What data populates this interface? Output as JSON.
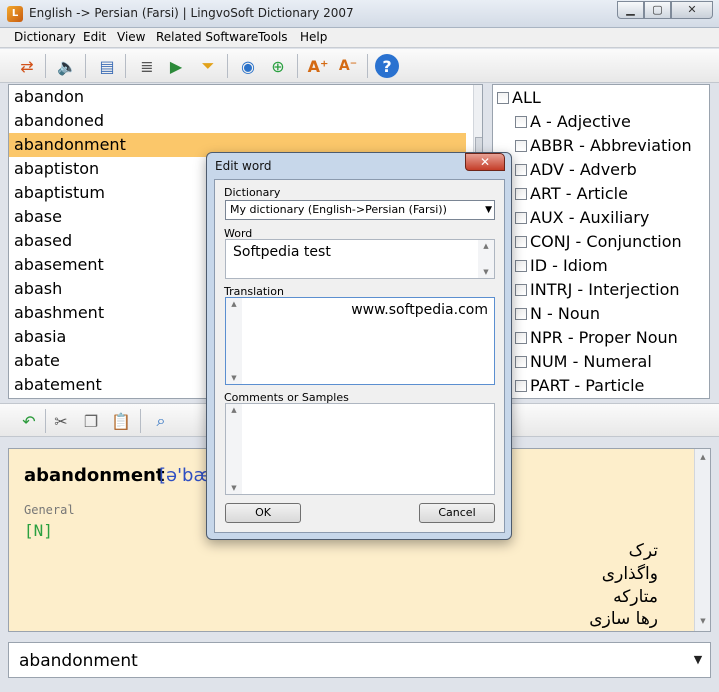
{
  "window": {
    "title": "English -> Persian (Farsi) | LingvoSoft Dictionary 2007",
    "minimize": "▁",
    "maximize": "▢",
    "close": "✕"
  },
  "menu": [
    "Dictionary",
    "Edit",
    "View",
    "Related Software",
    "Tools",
    "Help"
  ],
  "words": [
    "abandon",
    "abandoned",
    "abandonment",
    "abaptiston",
    "abaptistum",
    "abase",
    "abased",
    "abasement",
    "abash",
    "abashment",
    "abasia",
    "abate",
    "abatement"
  ],
  "selected_word_index": 2,
  "pos": [
    "ALL",
    "A - Adjective",
    "ABBR - Abbreviation",
    "ADV - Adverb",
    "ART - Article",
    "AUX - Auxiliary",
    "CONJ - Conjunction",
    "ID - Idiom",
    "INTRJ - Interjection",
    "N - Noun",
    "NPR - Proper Noun",
    "NUM - Numeral",
    "PART - Particle"
  ],
  "article": {
    "headword": "abandonment",
    "ipa": "[ə'bæ",
    "label": "General",
    "pos": "[N]",
    "translations": [
      "ترک",
      "واگذاری",
      "متارکه",
      "رها سازی"
    ]
  },
  "search": {
    "value": "abandonment",
    "dropdown": "▼"
  },
  "dialog": {
    "title": "Edit word",
    "close": "✕",
    "dictionary_label": "Dictionary",
    "dictionary_value": "My dictionary (English->Persian (Farsi))",
    "dictionary_arrow": "▼",
    "word_label": "Word",
    "word_value": "Softpedia test",
    "translation_label": "Translation",
    "translation_value": "www.softpedia.com",
    "comments_label": "Comments or Samples",
    "ok": "OK",
    "cancel": "Cancel"
  },
  "colors": {
    "selected_row": "#fbc76a",
    "article_bg": "#fdeecb",
    "ipa": "#2f4fc2",
    "pos_tag": "#2aa040"
  }
}
